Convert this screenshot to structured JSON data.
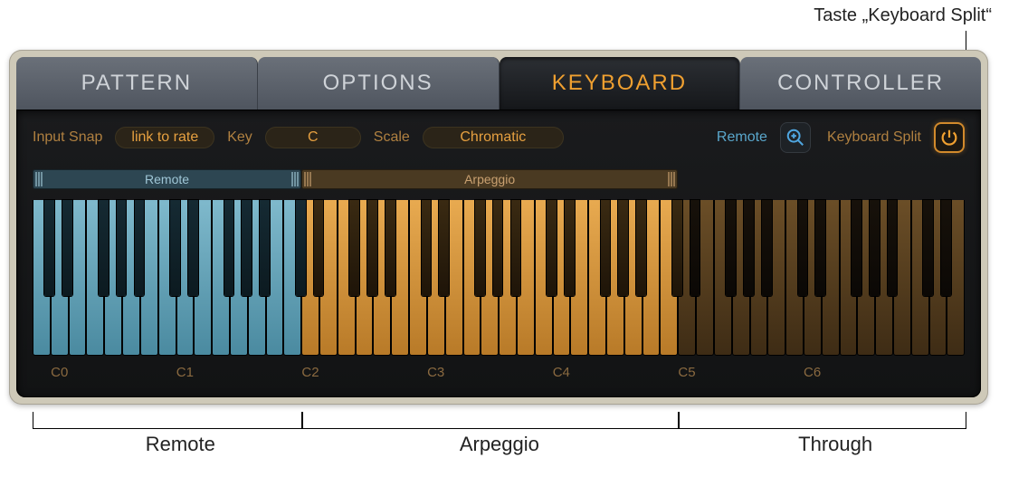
{
  "annotations": {
    "top_callout": "Taste „Keyboard Split“",
    "bottom_remote_label": "Remote",
    "bottom_arpeggio_label": "Arpeggio",
    "bottom_through_label": "Through"
  },
  "tabs": {
    "pattern": "PATTERN",
    "options": "OPTIONS",
    "keyboard": "KEYBOARD",
    "controller": "CONTROLLER",
    "active": "keyboard"
  },
  "params": {
    "input_snap_label": "Input Snap",
    "input_snap_value": "link to rate",
    "key_label": "Key",
    "key_value": "C",
    "scale_label": "Scale",
    "scale_value": "Chromatic",
    "remote_label": "Remote",
    "keyboard_split_label": "Keyboard Split"
  },
  "ranges": {
    "remote_label": "Remote",
    "arpeggio_label": "Arpeggio"
  },
  "keyboard": {
    "c_labels": [
      "C0",
      "C1",
      "C2",
      "C3",
      "C4",
      "C5",
      "C6"
    ],
    "zones": {
      "remote": {
        "start_octave": 0,
        "end_white_index": 15
      },
      "arpeggio": {
        "start_white_index": 15,
        "end_white_index": 36
      },
      "through": {
        "start_white_index": 36,
        "end_white_index": 52
      }
    }
  }
}
